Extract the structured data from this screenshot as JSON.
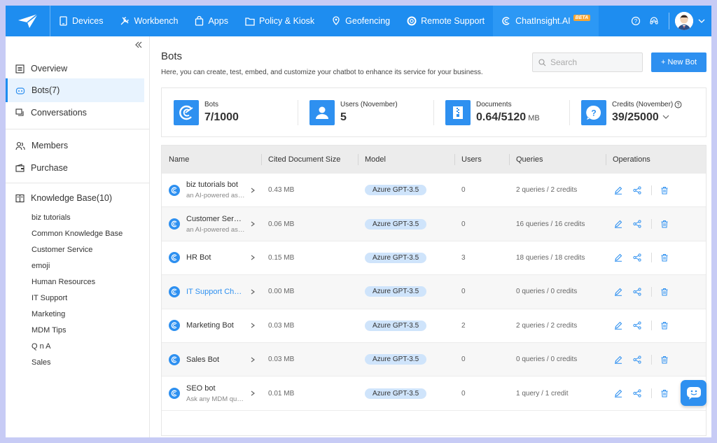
{
  "topnav": {
    "items": [
      {
        "label": "Devices",
        "icon": "tablet-icon"
      },
      {
        "label": "Workbench",
        "icon": "tools-icon"
      },
      {
        "label": "Apps",
        "icon": "bag-icon"
      },
      {
        "label": "Policy & Kiosk",
        "icon": "folder-icon"
      },
      {
        "label": "Geofencing",
        "icon": "map-pin-icon"
      },
      {
        "label": "Remote Support",
        "icon": "lifebuoy-icon"
      },
      {
        "label": "ChatInsight.AI",
        "icon": "chatinsight-icon",
        "badge": "BETA"
      }
    ],
    "brand_color": "#1e8df0"
  },
  "sidebar": {
    "items": [
      {
        "label": "Overview",
        "icon": "list-icon"
      },
      {
        "label": "Bots(7)",
        "icon": "bot-icon",
        "active": true
      },
      {
        "label": "Conversations",
        "icon": "chat-icon"
      },
      {
        "label": "Members",
        "icon": "users-icon"
      },
      {
        "label": "Purchase",
        "icon": "wallet-icon"
      },
      {
        "label": "Knowledge Base(10)",
        "icon": "book-icon"
      }
    ],
    "knowledge_bases": [
      "biz tutorials",
      "Common Knowledge Base",
      "Customer Service",
      "emoji",
      "Human Resources",
      "IT Support",
      "Marketing",
      "MDM Tips",
      "Q n A",
      "Sales"
    ]
  },
  "main": {
    "title": "Bots",
    "description": "Here, you can create, test, embed, and customize your chatbot to enhance its service for your business.",
    "search_placeholder": "Search",
    "new_button": "+ New Bot"
  },
  "stats": [
    {
      "label": "Bots",
      "value": "7/1000",
      "unit": ""
    },
    {
      "label": "Users (November)",
      "value": "5",
      "unit": ""
    },
    {
      "label": "Documents",
      "value": "0.64/5120",
      "unit": "MB"
    },
    {
      "label": "Credits (November)",
      "value": "39/25000",
      "unit": ""
    }
  ],
  "table": {
    "headers": [
      "Name",
      "Cited Document Size",
      "Model",
      "Users",
      "Queries",
      "Operations"
    ],
    "rows": [
      {
        "name": "biz tutorials bot",
        "desc": "an AI-powered assistant",
        "size": "0.43 MB",
        "model": "Azure GPT-3.5",
        "users": "0",
        "queries": "2 queries  / 2 credits"
      },
      {
        "name": "Customer Service Bot",
        "desc": "an AI-powered assistant",
        "size": "0.06 MB",
        "model": "Azure GPT-3.5",
        "users": "0",
        "queries": "16 queries  / 16 credits"
      },
      {
        "name": "HR Bot",
        "desc": "",
        "size": "0.15 MB",
        "model": "Azure GPT-3.5",
        "users": "3",
        "queries": "18 queries  / 18 credits"
      },
      {
        "name": "IT Support Chatbot",
        "desc": "",
        "size": "0.00 MB",
        "model": "Azure GPT-3.5",
        "users": "0",
        "queries": "0 queries  / 0 credits",
        "highlight": true
      },
      {
        "name": "Marketing Bot",
        "desc": "",
        "size": "0.03 MB",
        "model": "Azure GPT-3.5",
        "users": "2",
        "queries": "2 queries  / 2 credits"
      },
      {
        "name": "Sales Bot",
        "desc": "",
        "size": "0.03 MB",
        "model": "Azure GPT-3.5",
        "users": "0",
        "queries": "0 queries  / 0 credits"
      },
      {
        "name": "SEO bot",
        "desc": "Ask any MDM question",
        "size": "0.01 MB",
        "model": "Azure GPT-3.5",
        "users": "0",
        "queries": "1 query  / 1 credit"
      }
    ]
  }
}
